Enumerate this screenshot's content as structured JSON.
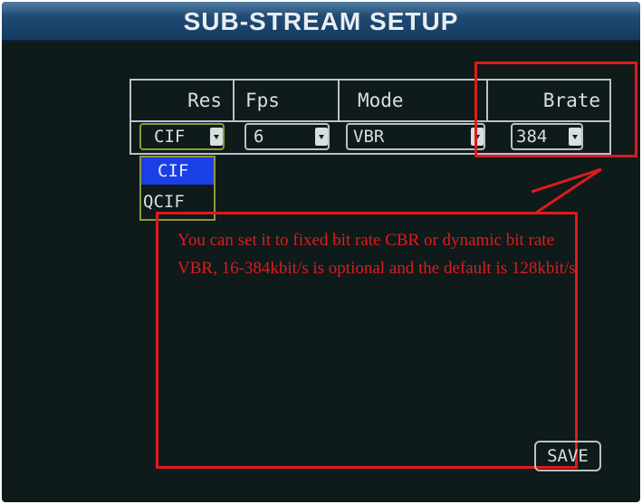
{
  "title": "SUB-STREAM SETUP",
  "table": {
    "headers": [
      "Res",
      "Fps",
      "Mode",
      "Brate"
    ],
    "res_value": "CIF",
    "fps_value": "6",
    "mode_value": "VBR",
    "brate_value": "384"
  },
  "dropdown": {
    "options": [
      "CIF",
      "QCIF"
    ],
    "highlighted": "CIF"
  },
  "annotation": {
    "text": "You can set it to fixed bit rate CBR or dynamic bit rate VBR, 16-384kbit/s is optional and the default is 128kbit/s"
  },
  "save_label": "SAVE",
  "colors": {
    "background": "#0f1a1b",
    "title_bar": "#1f4a74",
    "annotation_red": "#e01a1a",
    "highlight_blue": "#1b3fe6",
    "focus_olive": "#8c9a3a"
  }
}
